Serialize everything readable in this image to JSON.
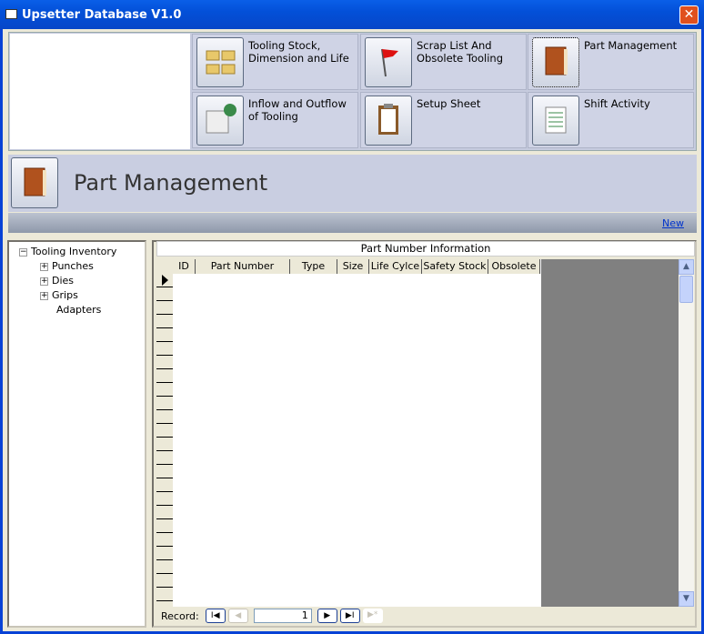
{
  "window": {
    "title": "Upsetter Database V1.0",
    "close": "✕"
  },
  "switchboard": [
    {
      "label": "Tooling Stock, Dimension and Life",
      "icon": "folders-icon"
    },
    {
      "label": "Scrap List And Obsolete Tooling",
      "icon": "red-flag-icon"
    },
    {
      "label": "Part Management",
      "icon": "book-icon"
    },
    {
      "label": "Inflow and Outflow of Tooling",
      "icon": "calendar-globe-icon"
    },
    {
      "label": "Setup Sheet",
      "icon": "clipboard-icon"
    },
    {
      "label": "Shift Activity",
      "icon": "spreadsheet-icon"
    }
  ],
  "header": {
    "title": "Part Management",
    "new_link": "New"
  },
  "tree": {
    "root": "Tooling Inventory",
    "children": [
      "Punches",
      "Dies",
      "Grips",
      "Adapters"
    ],
    "expand": "+",
    "collapse": "−"
  },
  "subform": {
    "title": "Part Number Information",
    "columns": [
      "ID",
      "Part Number",
      "Type",
      "Size",
      "Life Cylce",
      "Safety Stock",
      "Obsolete"
    ]
  },
  "nav": {
    "label": "Record:",
    "current": "1",
    "first": "I◀",
    "prev": "◀",
    "next": "▶",
    "last": "▶I",
    "new": "▶*"
  }
}
